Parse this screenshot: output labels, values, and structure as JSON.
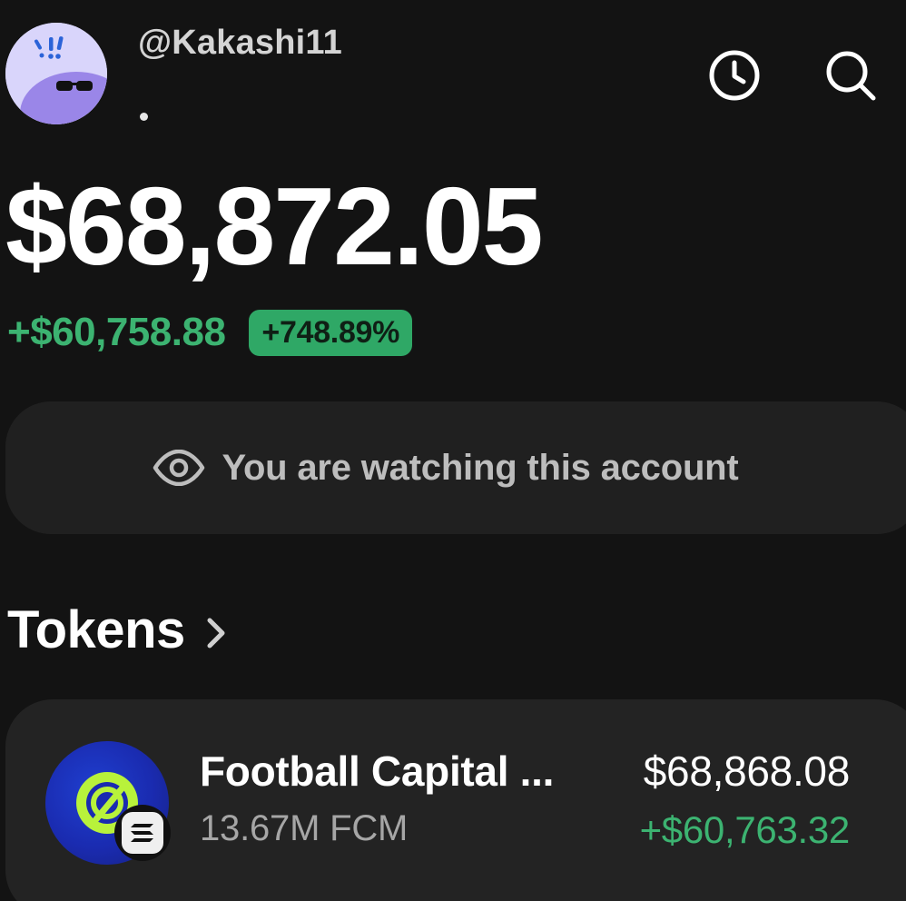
{
  "header": {
    "username": "@Kakashi11",
    "history_icon": "clock-icon",
    "search_icon": "search-icon",
    "avatar_icon": "avatar-sunglasses-icon"
  },
  "balance": {
    "total": "$68,872.05",
    "change_value": "+$60,758.88",
    "change_percent": "+748.89%"
  },
  "watching": {
    "icon": "eye-icon",
    "text": "You are watching this account"
  },
  "tokens": {
    "title": "Tokens",
    "chevron_icon": "chevron-right-icon",
    "items": [
      {
        "name": "Football Capital ...",
        "amount": "13.67M FCM",
        "value": "$68,868.08",
        "change": "+$60,763.32",
        "logo_icon": "fcm-token-logo",
        "chain_icon": "solana-chain-icon"
      }
    ]
  },
  "colors": {
    "background": "#131313",
    "positive": "#3cb371",
    "badge": "#2fa866",
    "card": "#232323",
    "avatar_bg": "#d9d5fb"
  }
}
